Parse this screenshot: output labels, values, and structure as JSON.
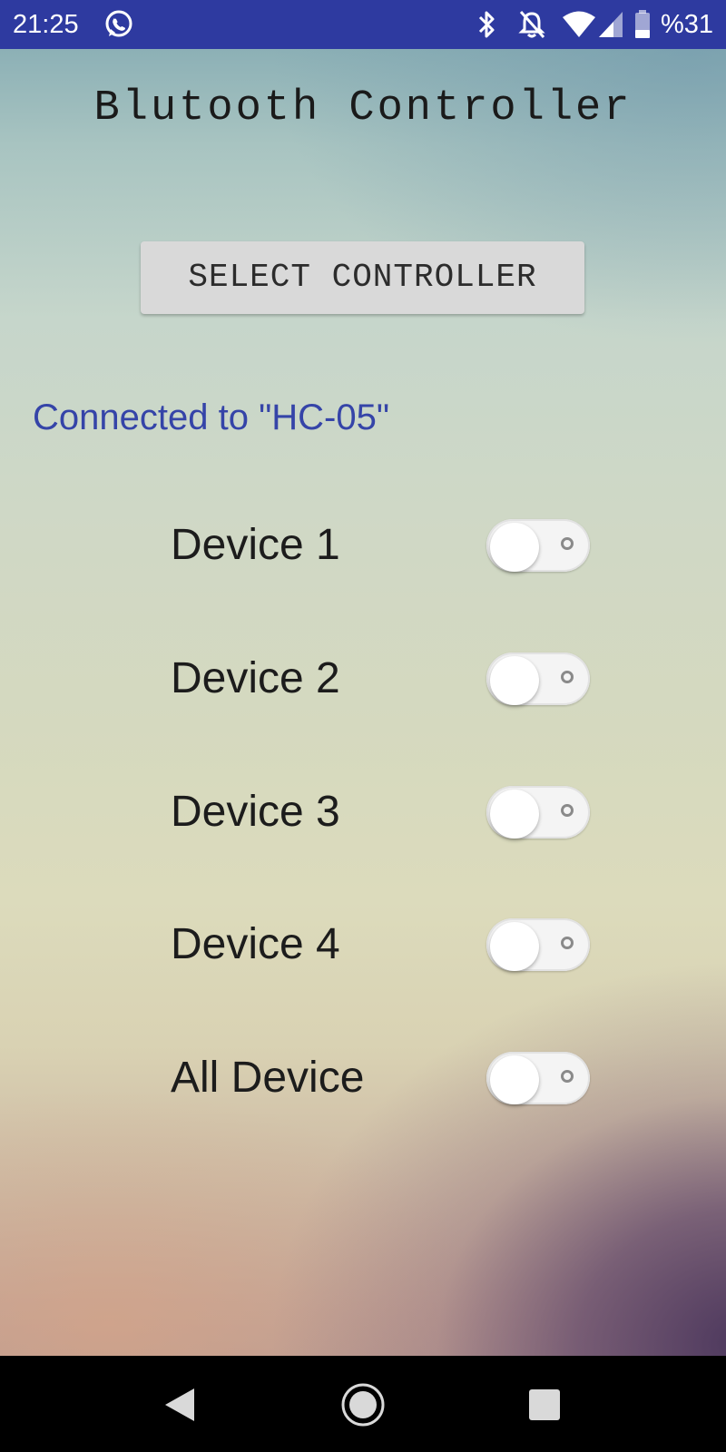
{
  "status_bar": {
    "time": "21:25",
    "battery": "%31",
    "icons": [
      "whatsapp-icon",
      "bluetooth-icon",
      "notifications-off-icon",
      "wifi-icon",
      "signal-icon",
      "battery-icon"
    ],
    "background_color": "#2e3aa0"
  },
  "app": {
    "title": "Blutooth Controller",
    "select_button_label": "SELECT CONTROLLER",
    "connection_status": "Connected to \"HC-05\"",
    "connection_status_color": "#3544a8"
  },
  "devices": [
    {
      "label": "Device 1",
      "on": false
    },
    {
      "label": "Device 2",
      "on": false
    },
    {
      "label": "Device 3",
      "on": false
    },
    {
      "label": "Device 4",
      "on": false
    },
    {
      "label": "All Device",
      "on": false
    }
  ],
  "nav_bar": {
    "buttons": [
      "back-icon",
      "home-icon",
      "recents-icon"
    ]
  }
}
